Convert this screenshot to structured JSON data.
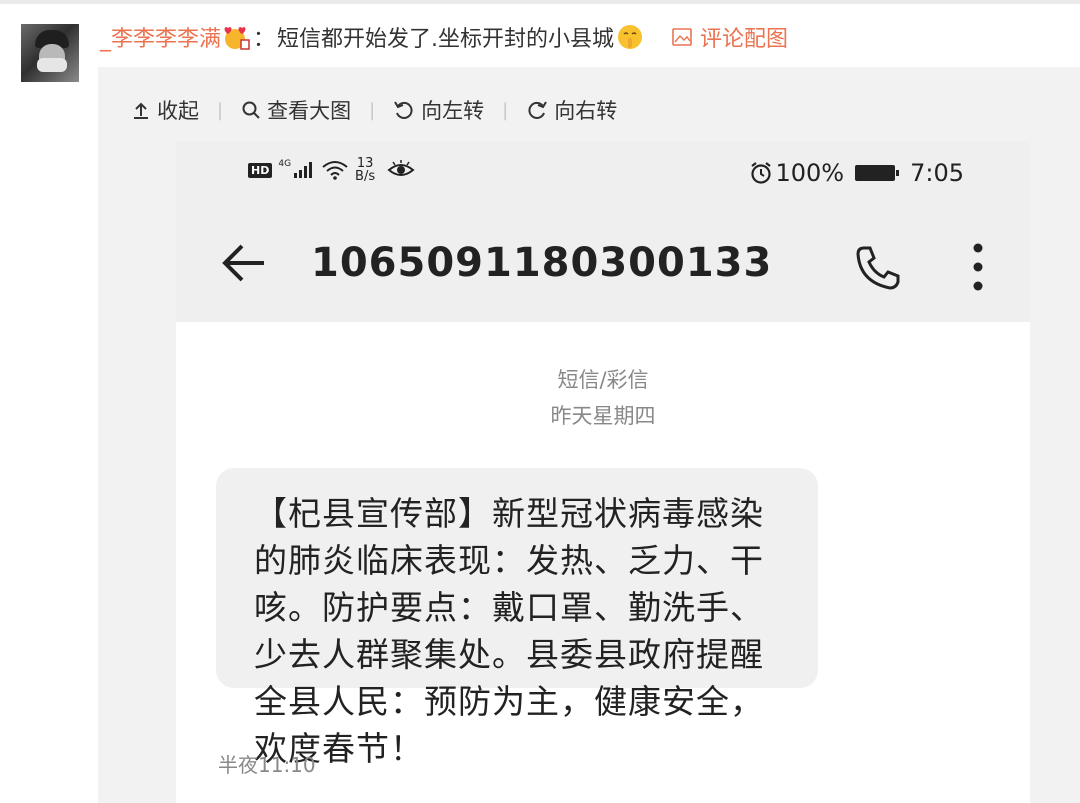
{
  "comment": {
    "username": "_李李李李满",
    "colon": "：",
    "text": "短信都开始发了.坐标开封的小县城",
    "pic_link_label": "评论配图"
  },
  "toolbar": {
    "collapse_label": "收起",
    "view_large_label": "查看大图",
    "rotate_left_label": "向左转",
    "rotate_right_label": "向右转",
    "separator": "|"
  },
  "screenshot": {
    "status_bar": {
      "hd": "HD",
      "network": "4G",
      "speed_value": "13",
      "speed_unit": "B/s",
      "battery": "100%",
      "time": "7:05"
    },
    "sender_number": "1065091180300133",
    "message_type": "短信/彩信",
    "date_label": "昨天星期四",
    "message_text": "【杞县宣传部】新型冠状病毒感染的肺炎临床表现：发热、乏力、干咳。防护要点：戴口罩、勤洗手、少去人群聚集处。县委县政府提醒全县人民：预防为主，健康安全，欢度春节！",
    "message_time": "半夜11:10"
  },
  "colors": {
    "accent": "#eb7350",
    "panel_bg": "#f2f2f2",
    "header_bg": "#efefef",
    "bubble_bg": "#f0f0f0"
  },
  "icons": [
    "collapse-icon",
    "search-icon",
    "rotate-left-icon",
    "rotate-right-icon",
    "image-icon",
    "back-arrow-icon",
    "phone-call-icon",
    "more-vertical-icon",
    "alarm-icon",
    "battery-icon",
    "signal-icon",
    "wifi-icon",
    "eye-icon"
  ]
}
